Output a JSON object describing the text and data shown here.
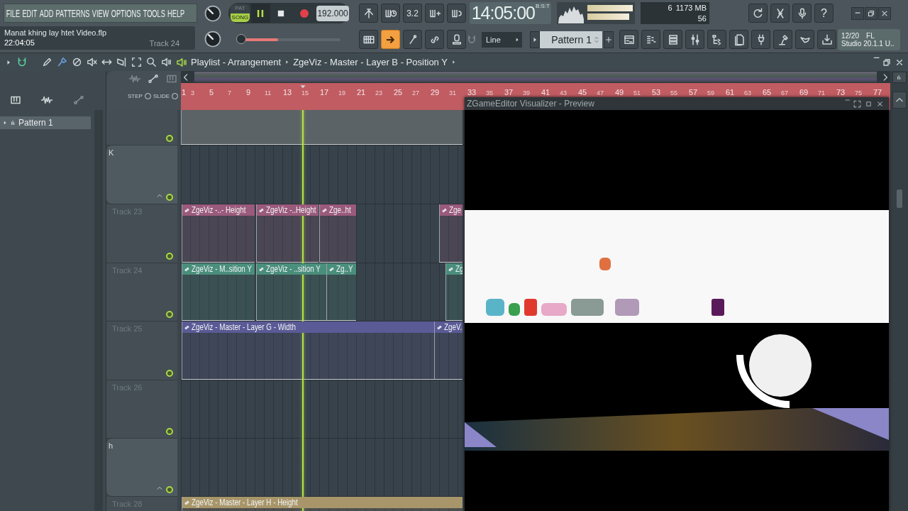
{
  "menu": [
    "FILE",
    "EDIT",
    "ADD",
    "PATTERNS",
    "VIEW",
    "OPTIONS",
    "TOOLS",
    "HELP"
  ],
  "hint": {
    "project": "Manat khing lay htet Video.flp",
    "time": "22:04:05",
    "track": "Track 24"
  },
  "transport": {
    "modes": [
      {
        "label": "PAT",
        "selected": false
      },
      {
        "label": "SONG",
        "selected": true
      }
    ],
    "playing": true,
    "tempo": "192.000"
  },
  "pitch": {
    "level": 0.37
  },
  "tools_top": [
    {
      "kind": "branch"
    },
    {
      "kind": "keys-clock"
    },
    {
      "kind": "text",
      "label": "3.2"
    },
    {
      "kind": "keys-plus"
    },
    {
      "kind": "keys-loop"
    }
  ],
  "tools_bottom": [
    {
      "kind": "keyboard",
      "selected": false
    },
    {
      "kind": "arrow",
      "selected": true
    },
    {
      "kind": "curve",
      "selected": false
    },
    {
      "kind": "link",
      "selected": false
    },
    {
      "kind": "stamp",
      "selected": false
    }
  ],
  "clock": {
    "time": "14:05:00",
    "unit": "B:S:T"
  },
  "stats": {
    "voices": "6",
    "memory": "1173 MB",
    "cpu": "56"
  },
  "help": "?",
  "snap": "Line",
  "pattern": "Pattern 1",
  "version": {
    "date": "12/20",
    "app": "FL",
    "release": "Studio 20.1.1 U.."
  },
  "playlist": {
    "title": "Playlist - Arrangement",
    "breadcrumb": "ZgeViz - Master - Layer B - Position Y",
    "step_label": "STEP",
    "slide_label": "SLIDE",
    "picker": [
      {
        "label": "Pattern 1",
        "selected": true
      }
    ],
    "ruler": [
      "1",
      "3",
      "5",
      "7",
      "9",
      "11",
      "13",
      "15",
      "17",
      "19",
      "21",
      "23",
      "25",
      "27",
      "29",
      "31",
      "33",
      "35",
      "37",
      "39",
      "41",
      "43",
      "45",
      "47",
      "49",
      "51",
      "53",
      "55",
      "57",
      "59",
      "61",
      "63",
      "65",
      "67",
      "69",
      "71",
      "73",
      "75",
      "77"
    ],
    "tracks": [
      {
        "kind": "track",
        "on": true,
        "clips": [
          {
            "color": "#5c6366"
          }
        ]
      },
      {
        "kind": "group",
        "label": "K",
        "on": true
      },
      {
        "kind": "track",
        "label": "Track 23",
        "on": true,
        "clips": [
          {
            "label": "ZgeViz -..- Height",
            "color": "#9a5a7c"
          },
          {
            "label": "ZgeViz -..Height",
            "color": "#9a5a7c"
          },
          {
            "label": "Zge..ht",
            "color": "#9a5a7c"
          },
          {
            "label": "Zge",
            "color": "#9a5a7c"
          }
        ]
      },
      {
        "kind": "track",
        "label": "Track 24",
        "on": true,
        "clips": [
          {
            "label": "ZgeViz - M..sition Y",
            "color": "#4a8e7c"
          },
          {
            "label": "ZgeViz - ..sition Y",
            "color": "#4a8e7c"
          },
          {
            "label": "Zg..Y",
            "color": "#4a8e7c"
          },
          {
            "label": "Zg",
            "color": "#4a8e7c"
          }
        ]
      },
      {
        "kind": "track",
        "label": "Track 25",
        "on": true,
        "clips": [
          {
            "label": "ZgeViz - Master - Layer G - Width",
            "color": "#5a5a96"
          },
          {
            "label": "ZgeV..",
            "color": "#5a5a96"
          }
        ]
      },
      {
        "kind": "track",
        "label": "Track 26",
        "on": true
      },
      {
        "kind": "group",
        "label": "h",
        "on": true
      },
      {
        "kind": "track",
        "label": "Track 28",
        "clips": [
          {
            "label": "ZgeViz - Master - Layer H - Height",
            "color": "#a8966a"
          }
        ]
      }
    ]
  },
  "preview": {
    "title": "ZGameEditor Visualizer - Preview",
    "kind": "picture"
  }
}
